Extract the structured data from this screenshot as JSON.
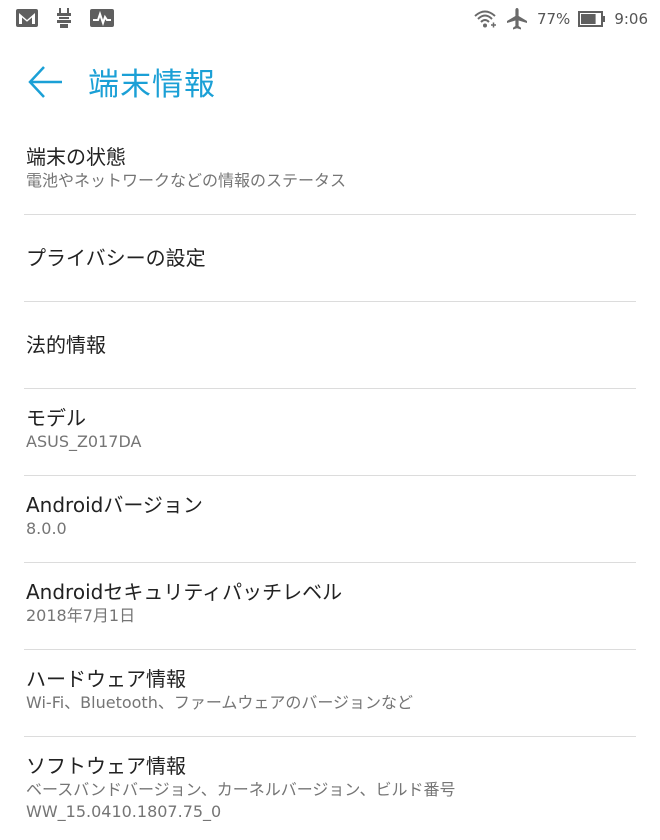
{
  "status_bar": {
    "left_icons": [
      "gmail-icon",
      "usb-debug-icon",
      "activity-icon"
    ],
    "battery_percent": "77%",
    "battery_level": 0.77,
    "time": "9:06",
    "right_icons": [
      "wifi-icon",
      "airplane-mode-icon",
      "battery-icon"
    ]
  },
  "header": {
    "back_icon": "arrow-left-icon",
    "title": "端末情報",
    "accent_color": "#1ba0d6"
  },
  "settings": {
    "items": [
      {
        "id": "device-status",
        "title": "端末の状態",
        "summary": "電池やネットワークなどの情報のステータス"
      },
      {
        "id": "privacy-settings",
        "title": "プライバシーの設定",
        "summary": ""
      },
      {
        "id": "legal-info",
        "title": "法的情報",
        "summary": ""
      },
      {
        "id": "model",
        "title": "モデル",
        "summary": "ASUS_Z017DA"
      },
      {
        "id": "android-version",
        "title": "Androidバージョン",
        "summary": "8.0.0"
      },
      {
        "id": "security-patch",
        "title": "Androidセキュリティパッチレベル",
        "summary": "2018年7月1日"
      },
      {
        "id": "hardware-info",
        "title": "ハードウェア情報",
        "summary": "Wi-Fi、Bluetooth、ファームウェアのバージョンなど"
      },
      {
        "id": "software-info",
        "title": "ソフトウェア情報",
        "summary": "ベースバンドバージョン、カーネルバージョン、ビルド番号",
        "summary2": "WW_15.0410.1807.75_0"
      }
    ]
  }
}
